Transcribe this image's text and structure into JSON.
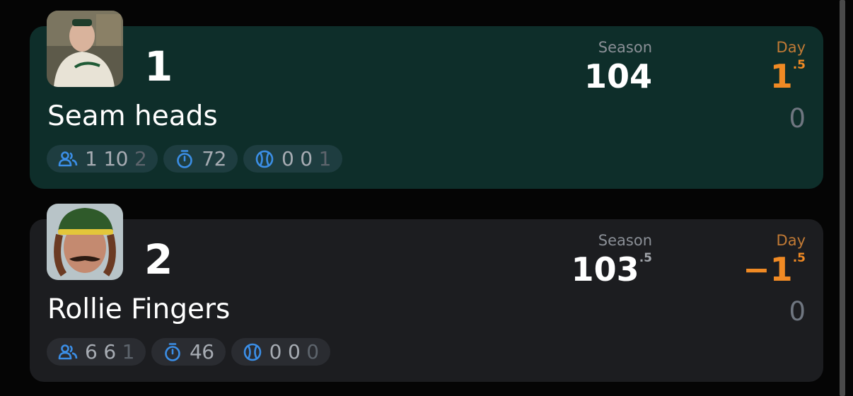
{
  "colors": {
    "accent_blue": "#3b8ee6",
    "day_orange": "#f08a24",
    "first_card_bg": "#0e2e2a",
    "second_card_bg": "#1c1d20"
  },
  "teams": [
    {
      "rank": "1",
      "name": "Seam heads",
      "avatar_icon": "manager-avatar",
      "season_label": "Season",
      "season_whole": "104",
      "season_frac": "",
      "day_label": "Day",
      "day_whole": "1",
      "day_frac": ".5",
      "day_secondary": "0",
      "pills": {
        "players_icon": "users-icon",
        "players": [
          "1",
          "10",
          "2"
        ],
        "timer_icon": "stopwatch-icon",
        "timer": "72",
        "ball_icon": "baseball-icon",
        "ball": [
          "0",
          "0",
          "1"
        ]
      }
    },
    {
      "rank": "2",
      "name": "Rollie Fingers",
      "avatar_icon": "player-avatar",
      "season_label": "Season",
      "season_whole": "103",
      "season_frac": ".5",
      "day_label": "Day",
      "day_whole": "−1",
      "day_frac": ".5",
      "day_secondary": "0",
      "pills": {
        "players_icon": "users-icon",
        "players": [
          "6",
          "6",
          "1"
        ],
        "timer_icon": "stopwatch-icon",
        "timer": "46",
        "ball_icon": "baseball-icon",
        "ball": [
          "0",
          "0",
          "0"
        ]
      }
    }
  ]
}
